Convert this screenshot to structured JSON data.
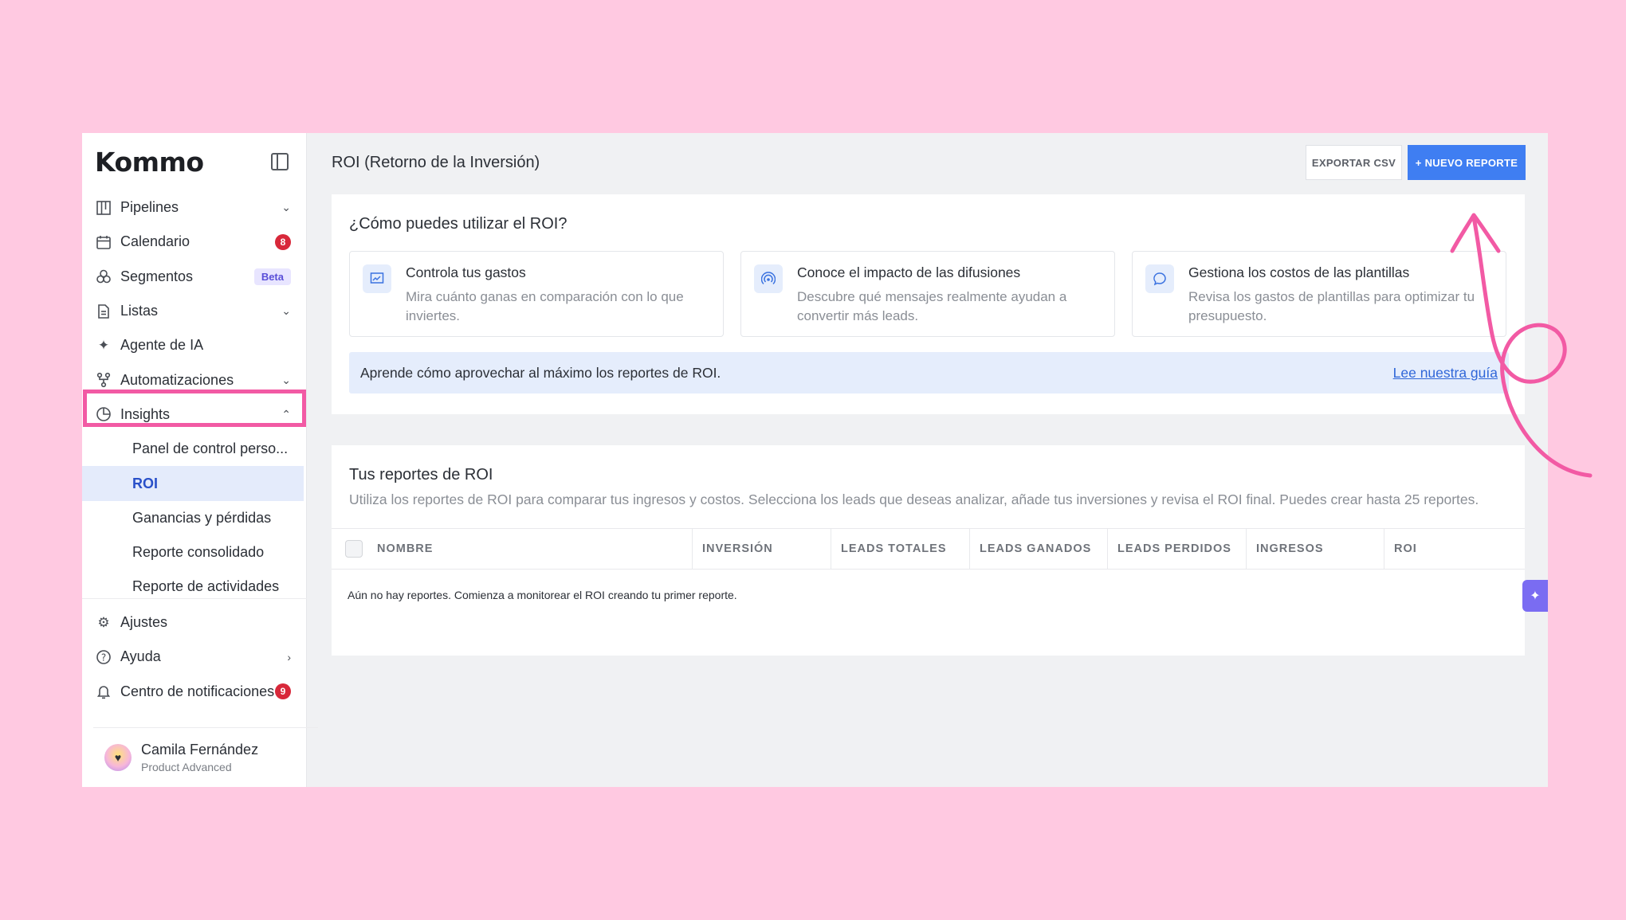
{
  "brand": {
    "logo": "Kommo"
  },
  "sidebar": {
    "items": [
      {
        "label": "Pipelines",
        "icon": "pipelines-icon"
      },
      {
        "label": "Calendario",
        "icon": "calendar-icon",
        "badge": "8"
      },
      {
        "label": "Segmentos",
        "icon": "segments-icon",
        "badge": "Beta"
      },
      {
        "label": "Listas",
        "icon": "lists-icon"
      },
      {
        "label": "Agente de IA",
        "icon": "ai-agent-icon"
      },
      {
        "label": "Automatizaciones",
        "icon": "automations-icon"
      },
      {
        "label": "Insights",
        "icon": "insights-icon"
      }
    ],
    "insights_sub": [
      {
        "label": "Panel de control perso..."
      },
      {
        "label": "ROI"
      },
      {
        "label": "Ganancias y pérdidas"
      },
      {
        "label": "Reporte consolidado"
      },
      {
        "label": "Reporte de actividades"
      }
    ],
    "bottom": [
      {
        "label": "Ajustes",
        "icon": "settings-icon"
      },
      {
        "label": "Ayuda",
        "icon": "help-icon"
      },
      {
        "label": "Centro de notificaciones",
        "icon": "bell-icon",
        "badge": "9"
      }
    ],
    "user": {
      "name": "Camila Fernández",
      "plan": "Product Advanced"
    }
  },
  "header": {
    "title": "ROI (Retorno de la Inversión)",
    "export_label": "EXPORTAR CSV",
    "new_report_label": "+ NUEVO REPORTE"
  },
  "intro": {
    "title": "¿Cómo puedes utilizar el ROI?",
    "tiles": [
      {
        "title": "Controla tus gastos",
        "desc": "Mira cuánto ganas en comparación con lo que inviertes."
      },
      {
        "title": "Conoce el impacto de las difusiones",
        "desc": "Descubre qué mensajes realmente ayudan a convertir más leads."
      },
      {
        "title": "Gestiona los costos de las plantillas",
        "desc": "Revisa los gastos de plantillas para optimizar tu presupuesto."
      }
    ],
    "info": "Aprende cómo aprovechar al máximo los reportes de ROI.",
    "info_link": "Lee nuestra guía"
  },
  "reports": {
    "title": "Tus reportes de ROI",
    "description": "Utiliza los reportes de ROI para comparar tus ingresos y costos. Selecciona los leads que deseas analizar, añade tus inversiones y revisa el ROI final. Puedes crear hasta 25 reportes.",
    "columns": [
      "NOMBRE",
      "INVERSIÓN",
      "LEADS TOTALES",
      "LEADS GANADOS",
      "LEADS PERDIDOS",
      "INGRESOS",
      "ROI"
    ],
    "empty": "Aún no hay reportes. Comienza a monitorear el ROI creando tu primer reporte."
  },
  "colors": {
    "accent": "#3f7ef2",
    "highlight": "#f25aa4",
    "background": "#ffc9e1"
  }
}
